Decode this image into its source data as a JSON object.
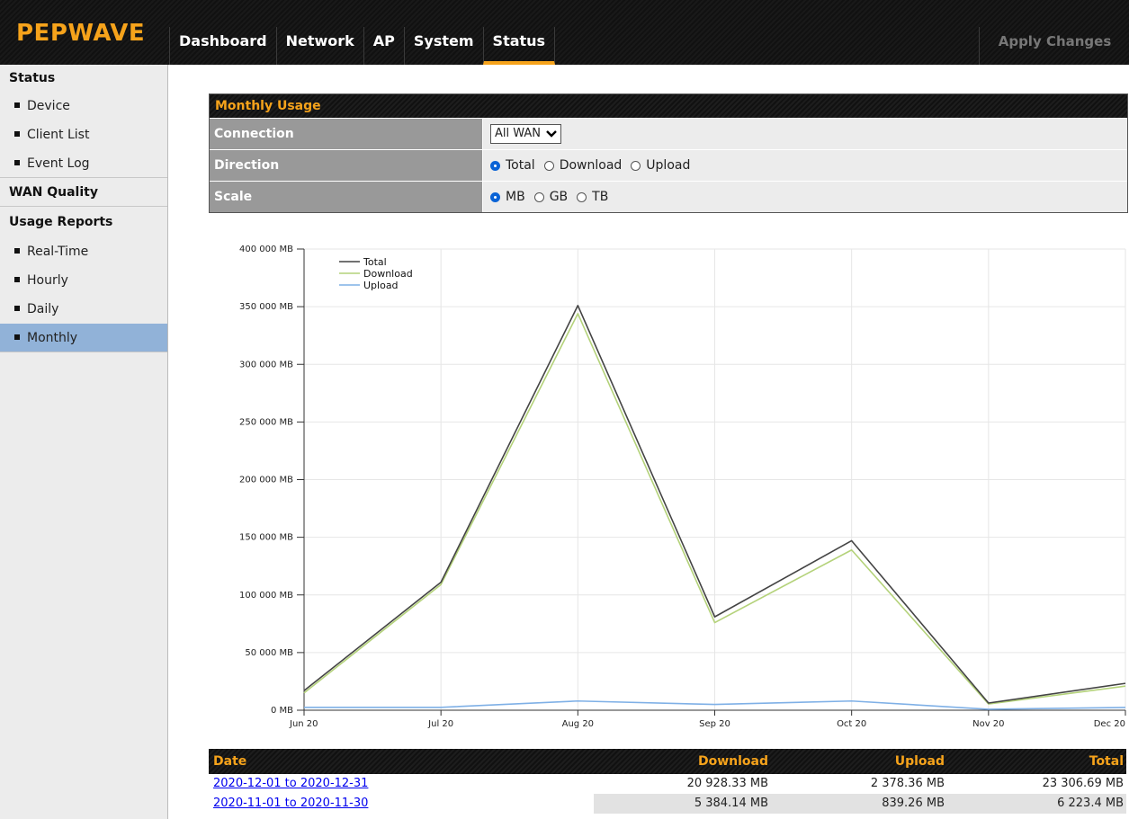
{
  "header": {
    "logo": "PEPWAVE",
    "tabs": [
      "Dashboard",
      "Network",
      "AP",
      "System",
      "Status"
    ],
    "active_tab": "Status",
    "apply_label": "Apply Changes",
    "accent_color": "#f6a31b"
  },
  "sidebar": {
    "sections": [
      {
        "heading": "Status",
        "items": [
          "Device",
          "Client List",
          "Event Log"
        ]
      },
      {
        "heading": "WAN Quality",
        "items": []
      },
      {
        "heading": "Usage Reports",
        "items": [
          "Real-Time",
          "Hourly",
          "Daily",
          "Monthly"
        ]
      }
    ],
    "active_item": "Monthly",
    "active_color": "#91b2d8"
  },
  "panel": {
    "title": "Monthly Usage",
    "connection": {
      "label": "Connection",
      "value": "All WAN"
    },
    "direction": {
      "label": "Direction",
      "options": [
        "Total",
        "Download",
        "Upload"
      ],
      "selected": "Total"
    },
    "scale": {
      "label": "Scale",
      "options": [
        "MB",
        "GB",
        "TB"
      ],
      "selected": "MB"
    }
  },
  "chart_data": {
    "type": "line",
    "categories": [
      "Jun 20",
      "Jul 20",
      "Aug 20",
      "Sep 20",
      "Oct 20",
      "Nov 20",
      "Dec 20"
    ],
    "series": [
      {
        "name": "Total",
        "color": "#444444",
        "values": [
          17000,
          111000,
          351000,
          81000,
          147000,
          6223.4,
          23306.69
        ]
      },
      {
        "name": "Download",
        "color": "#b4d27a",
        "values": [
          15000,
          109000,
          344000,
          76000,
          139000,
          5384.14,
          20928.33
        ]
      },
      {
        "name": "Upload",
        "color": "#7fb0e6",
        "values": [
          2500,
          2500,
          8000,
          5000,
          8000,
          839.26,
          2378.36
        ]
      }
    ],
    "y_ticks": [
      "0 MB",
      "50 000 MB",
      "100 000 MB",
      "150 000 MB",
      "200 000 MB",
      "250 000 MB",
      "300 000 MB",
      "350 000 MB",
      "400 000 MB"
    ],
    "ylim": [
      0,
      400000
    ],
    "grid": true,
    "legend": "top-left"
  },
  "table": {
    "headers": [
      "Date",
      "Download",
      "Upload",
      "Total"
    ],
    "rows": [
      {
        "date": "2020-12-01 to 2020-12-31",
        "download": "20 928.33 MB",
        "upload": "2 378.36 MB",
        "total": "23 306.69 MB"
      },
      {
        "date": "2020-11-01 to 2020-11-30",
        "download": "5 384.14 MB",
        "upload": "839.26 MB",
        "total": "6 223.4 MB"
      }
    ]
  }
}
